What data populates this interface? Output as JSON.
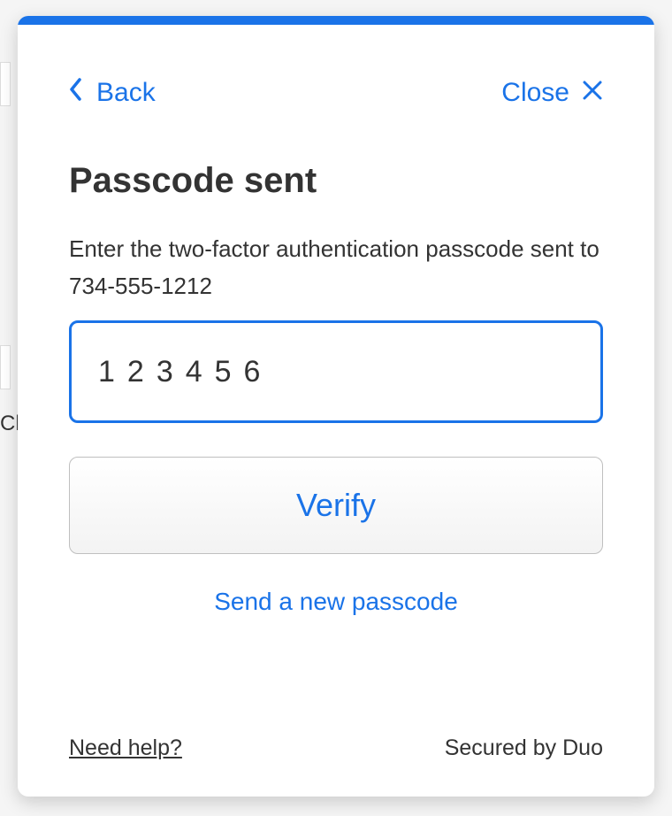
{
  "header": {
    "back_label": "Back",
    "close_label": "Close"
  },
  "title": "Passcode sent",
  "subtitle": "Enter the two-factor authentication passcode sent to 734-555-1212",
  "passcode_value": "123456",
  "verify_label": "Verify",
  "resend_label": "Send a new passcode",
  "footer": {
    "help_label": "Need help?",
    "secured_label": "Secured by Duo"
  },
  "background": {
    "partial_text": "Ch"
  }
}
